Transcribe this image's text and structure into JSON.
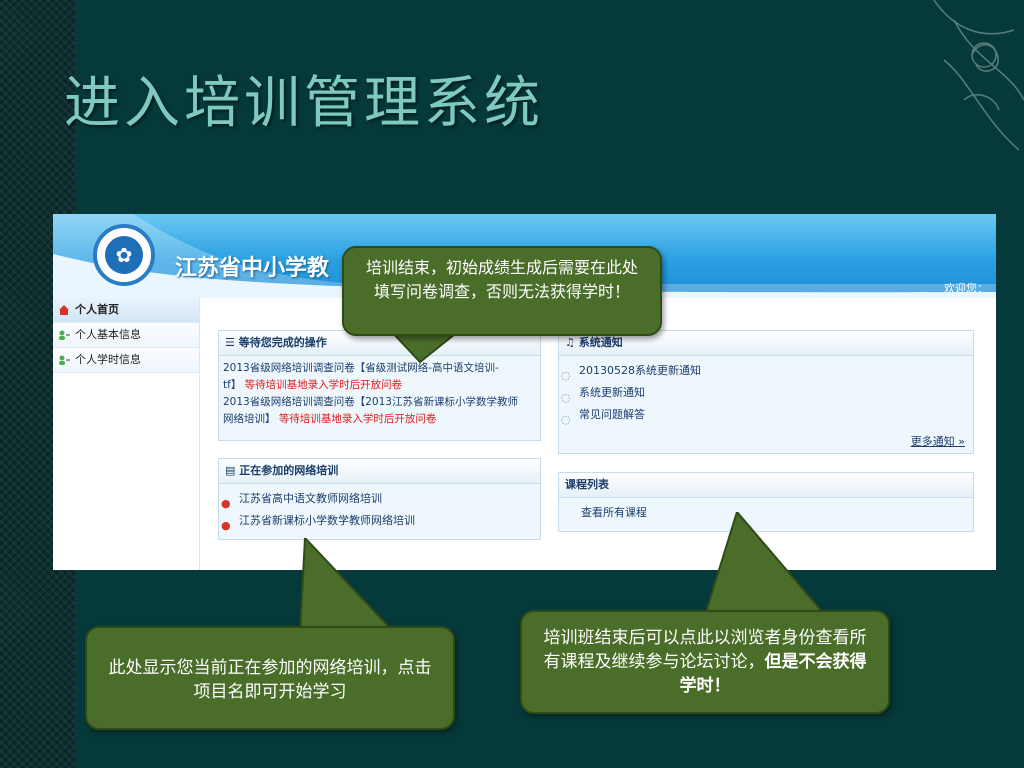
{
  "slide": {
    "title": "进入培训管理系统"
  },
  "header": {
    "site_title": "江苏省中小学教",
    "welcome": "欢迎您："
  },
  "sidebar": {
    "items": [
      {
        "label": "个人首页",
        "icon": "home-icon"
      },
      {
        "label": "个人基本信息",
        "icon": "user-icon"
      },
      {
        "label": "个人学时信息",
        "icon": "user-icon"
      }
    ]
  },
  "pending": {
    "title": "等待您完成的操作",
    "line1a": "2013省级网络培训调查问卷【省级测试网络-高中语文培训-",
    "line1b": "tf】",
    "line1c": "等待培训基地录入学时后开放问卷",
    "line2a": "2013省级网络培训调查问卷【2013江苏省新课标小学数学教师",
    "line2b": "网络培训】",
    "line2c": "等待培训基地录入学时后开放问卷"
  },
  "training": {
    "title": "正在参加的网络培训",
    "items": [
      "江苏省高中语文教师网络培训",
      "江苏省新课标小学数学教师网络培训"
    ]
  },
  "notices": {
    "title": "系统通知",
    "items": [
      "20130528系统更新通知",
      "系统更新通知",
      "常见问题解答"
    ],
    "more": "更多通知"
  },
  "courses": {
    "title": "课程列表",
    "link": "查看所有课程"
  },
  "callouts": {
    "top": "培训结束，初始成绩生成后需要在此处填写问卷调查，否则无法获得学时！",
    "bottom_left": "此处显示您当前正在参加的网络培训，点击项目名即可开始学习",
    "bottom_right_normal": "培训班结束后可以点此以浏览者身份查看所有课程及继续参与论坛讨论，",
    "bottom_right_bold": "但是不会获得学时！"
  },
  "colors": {
    "background": "#063a3a",
    "title": "#7fc9c0",
    "callout": "#4a6e2a",
    "banner": "#2aa0e3",
    "warning": "#e01b1b"
  }
}
